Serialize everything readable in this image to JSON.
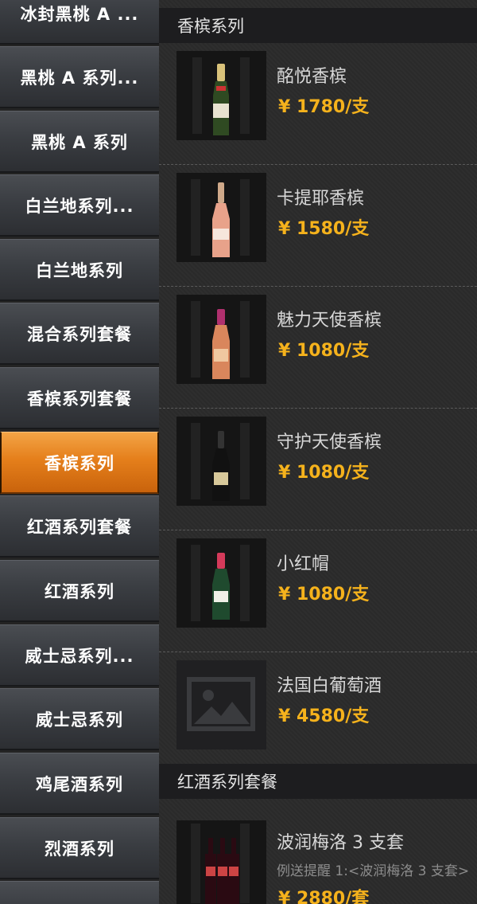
{
  "categories": [
    {
      "label": "冰封黑桃 A ...",
      "active": false
    },
    {
      "label": "黑桃 A 系列...",
      "active": false
    },
    {
      "label": "黑桃 A 系列",
      "active": false
    },
    {
      "label": "白兰地系列...",
      "active": false
    },
    {
      "label": "白兰地系列",
      "active": false
    },
    {
      "label": "混合系列套餐",
      "active": false
    },
    {
      "label": "香槟系列套餐",
      "active": false
    },
    {
      "label": "香槟系列",
      "active": true
    },
    {
      "label": "红酒系列套餐",
      "active": false
    },
    {
      "label": "红酒系列",
      "active": false
    },
    {
      "label": "威士忌系列...",
      "active": false
    },
    {
      "label": "威士忌系列",
      "active": false
    },
    {
      "label": "鸡尾酒系列",
      "active": false
    },
    {
      "label": "烈酒系列",
      "active": false
    }
  ],
  "sections": [
    {
      "title": "香槟系列",
      "products": [
        {
          "name": "酩悦香槟",
          "price": "¥ 1780/支",
          "icon": "champagne-bottle-icon",
          "bottle_color": "#2f4a22",
          "label_color": "#e8e2d0"
        },
        {
          "name": "卡提耶香槟",
          "price": "¥ 1580/支",
          "icon": "rose-champagne-bottle-icon",
          "bottle_color": "#e8a28a",
          "label_color": "#f6e6dc"
        },
        {
          "name": "魅力天使香槟",
          "price": "¥ 1080/支",
          "icon": "angel-champagne-bottle-icon",
          "bottle_color": "#d9865c",
          "label_color": "#b0306e"
        },
        {
          "name": "守护天使香槟",
          "price": "¥ 1080/支",
          "icon": "black-champagne-bottle-icon",
          "bottle_color": "#111111",
          "label_color": "#d7c89a"
        },
        {
          "name": "小红帽",
          "price": "¥ 1080/支",
          "icon": "red-cap-bottle-icon",
          "bottle_color": "#1f4a2e",
          "label_color": "#d43a5a"
        },
        {
          "name": "法国白葡萄酒",
          "price": "¥ 4580/支",
          "icon": "image-placeholder-icon"
        }
      ]
    },
    {
      "title": "红酒系列套餐",
      "products": [
        {
          "name": "波润梅洛 3 支套",
          "note": "例送提醒 1:<波润梅洛 3 支套>",
          "price": "¥ 2880/套",
          "icon": "red-wine-set-icon"
        }
      ]
    }
  ],
  "colors": {
    "accent": "#e57f1b",
    "price": "#f5b21c"
  }
}
